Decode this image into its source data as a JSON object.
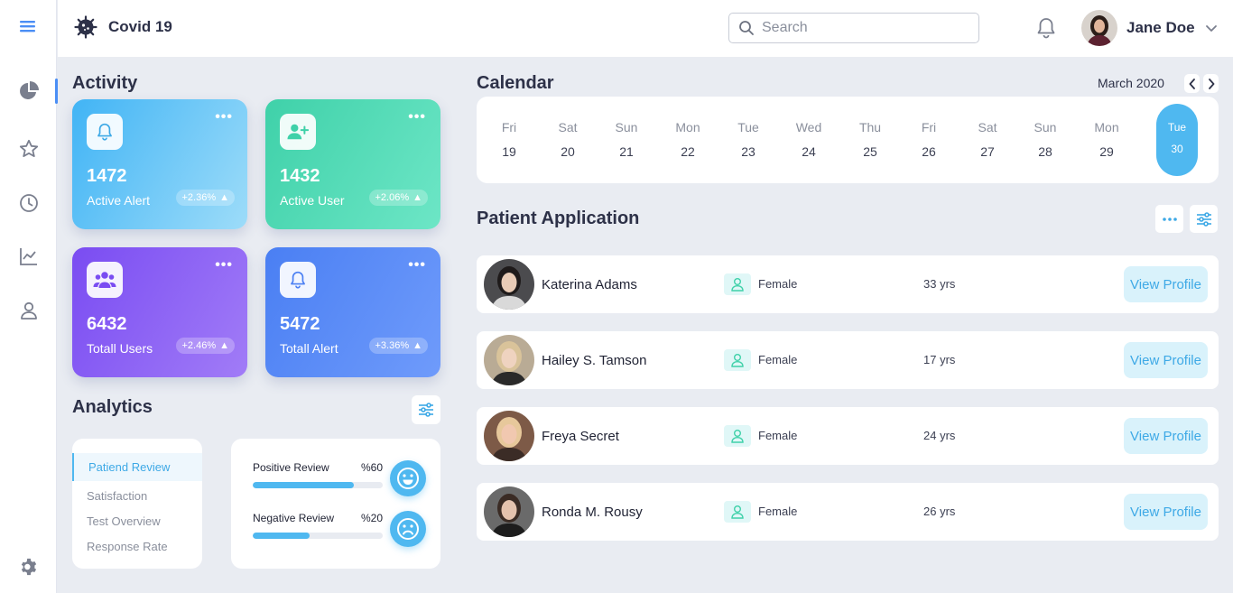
{
  "app": {
    "name": "Covid 19"
  },
  "search": {
    "placeholder": "Search"
  },
  "user": {
    "name": "Jane Doe"
  },
  "sidebar": {
    "items": [
      "dashboard",
      "favorites",
      "history",
      "stats",
      "profile"
    ]
  },
  "activity": {
    "title": "Activity",
    "cards": [
      {
        "value": "1472",
        "label": "Active Alert",
        "change": "+2.36%"
      },
      {
        "value": "1432",
        "label": "Active User",
        "change": "+2.06%"
      },
      {
        "value": "6432",
        "label": "Totall Users",
        "change": "+2.46%"
      },
      {
        "value": "5472",
        "label": "Totall Alert",
        "change": "+3.36%"
      }
    ]
  },
  "calendar": {
    "title": "Calendar",
    "month": "March 2020",
    "days": [
      {
        "name": "Fri",
        "date": "19"
      },
      {
        "name": "Sat",
        "date": "20"
      },
      {
        "name": "Sun",
        "date": "21"
      },
      {
        "name": "Mon",
        "date": "22"
      },
      {
        "name": "Tue",
        "date": "23"
      },
      {
        "name": "Wed",
        "date": "24"
      },
      {
        "name": "Thu",
        "date": "25"
      },
      {
        "name": "Fri",
        "date": "26"
      },
      {
        "name": "Sat",
        "date": "27"
      },
      {
        "name": "Sun",
        "date": "28"
      },
      {
        "name": "Mon",
        "date": "29"
      },
      {
        "name": "Tue",
        "date": "30"
      }
    ],
    "selected_index": 11
  },
  "patients": {
    "title": "Patient Application",
    "action_label": "View Profile",
    "rows": [
      {
        "name": "Katerina Adams",
        "gender": "Female",
        "age": "33 yrs"
      },
      {
        "name": "Hailey S. Tamson",
        "gender": "Female",
        "age": "17 yrs"
      },
      {
        "name": "Freya Secret",
        "gender": "Female",
        "age": "24 yrs"
      },
      {
        "name": "Ronda M. Rousy",
        "gender": "Female",
        "age": "26 yrs"
      }
    ]
  },
  "analytics": {
    "title": "Analytics",
    "menu": [
      "Patiend Review",
      "Satisfaction",
      "Test Overview",
      "Response Rate"
    ],
    "reviews": [
      {
        "label": "Positive Review",
        "percent_text": "%60",
        "fill": 0.78
      },
      {
        "label": "Negative Review",
        "percent_text": "%20",
        "fill": 0.44
      }
    ]
  },
  "colors": {
    "accent": "#4fb8f0",
    "primary": "#4b8ef5",
    "text": "#2d3148"
  }
}
